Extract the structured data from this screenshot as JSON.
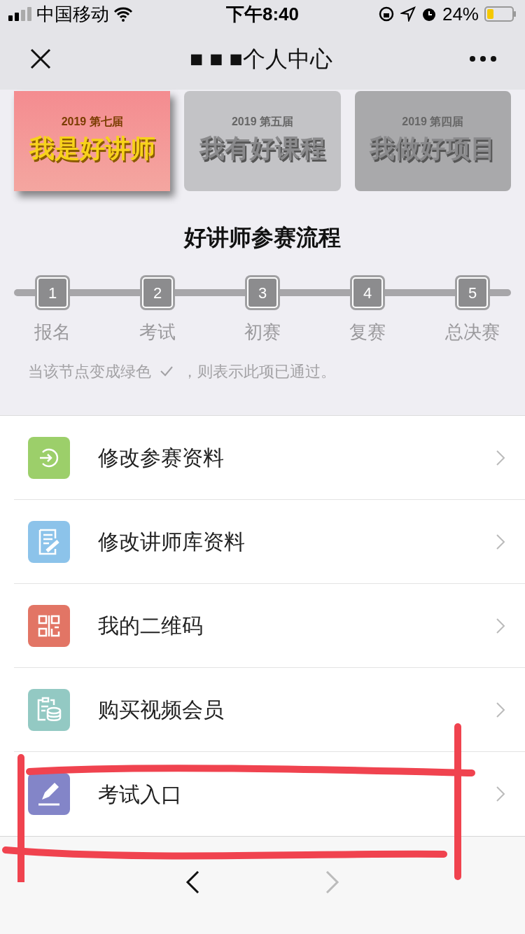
{
  "status_bar": {
    "carrier": "中国移动",
    "time": "下午8:40",
    "battery": "24%"
  },
  "nav_bar": {
    "title": "■ ■ ■个人中心"
  },
  "banners": [
    {
      "edition": "2019 第七届",
      "name": "我是好讲师",
      "selected": true
    },
    {
      "edition": "2019 第五届",
      "name": "我有好课程",
      "selected": false
    },
    {
      "edition": "2019 第四届",
      "name": "我做好项目",
      "selected": false
    }
  ],
  "flow": {
    "title": "好讲师参赛流程",
    "steps": [
      {
        "number": "1",
        "label": "报名",
        "passed": false
      },
      {
        "number": "2",
        "label": "考试",
        "passed": false
      },
      {
        "number": "3",
        "label": "初赛",
        "passed": false
      },
      {
        "number": "4",
        "label": "复赛",
        "passed": false
      },
      {
        "number": "5",
        "label": "总决赛",
        "passed": false
      }
    ],
    "note_before": "当该节点变成绿色",
    "note_after": "，则表示此项已通过。"
  },
  "menu": [
    {
      "kind": "enter",
      "label": "修改参赛资料",
      "color": "#9ccf6a"
    },
    {
      "kind": "edit_doc",
      "label": "修改讲师库资料",
      "color": "#8cc3ea"
    },
    {
      "kind": "qr",
      "label": "我的二维码",
      "color": "#e27565"
    },
    {
      "kind": "coins",
      "label": "购买视频会员",
      "color": "#93c9c3"
    },
    {
      "kind": "pen",
      "label": "考试入口",
      "color": "#8385c8"
    }
  ],
  "bottom_nav": {
    "back_disabled": false,
    "forward_disabled": true
  }
}
